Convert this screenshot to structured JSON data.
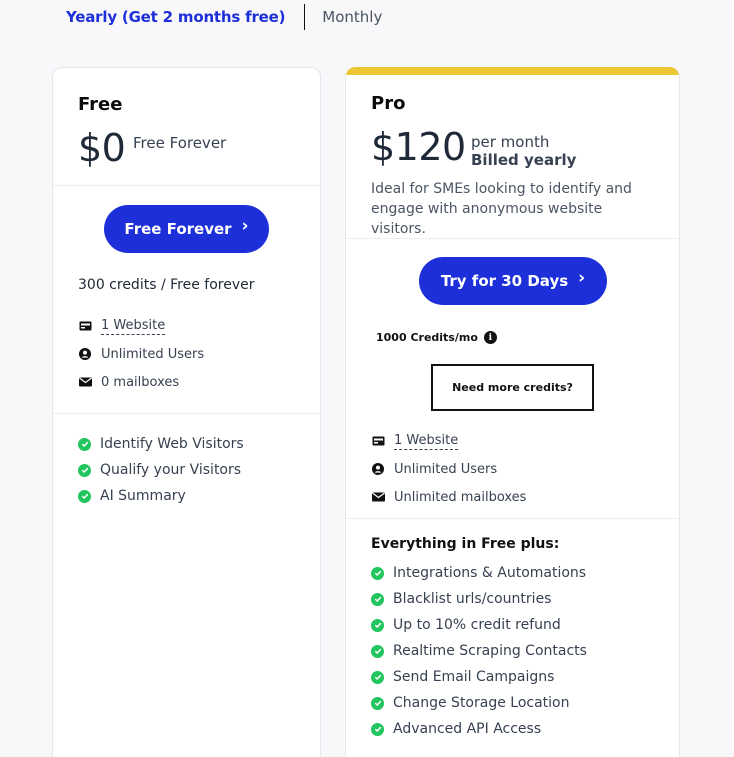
{
  "billing": {
    "yearly_label": "Yearly (Get 2 months free)",
    "monthly_label": "Monthly"
  },
  "colors": {
    "accent": "#1d2fd8",
    "pro_bar": "#ebc832",
    "check": "#22c55e"
  },
  "free": {
    "name": "Free",
    "price": "$0",
    "price_note": "Free Forever",
    "cta_label": "Free Forever",
    "credits": "300 credits / Free forever",
    "meta": [
      {
        "icon": "website-icon",
        "label": "1 Website",
        "link": true
      },
      {
        "icon": "user-icon",
        "label": "Unlimited Users",
        "link": false
      },
      {
        "icon": "mail-icon",
        "label": "0 mailboxes",
        "link": false
      }
    ],
    "features": [
      "Identify Web Visitors",
      "Qualify your Visitors",
      "AI Summary"
    ]
  },
  "pro": {
    "name": "Pro",
    "price": "$120",
    "price_note": "per month",
    "price_sub": "Billed yearly",
    "description": "Ideal for SMEs looking to identify and engage with anonymous website visitors.",
    "cta_label": "Try for 30 Days",
    "credits": "1000 Credits/mo",
    "more_credits_label": "Need more credits?",
    "meta": [
      {
        "icon": "website-icon",
        "label": "1 Website",
        "link": true
      },
      {
        "icon": "user-icon",
        "label": "Unlimited Users",
        "link": false
      },
      {
        "icon": "mail-icon",
        "label": "Unlimited mailboxes",
        "link": false
      }
    ],
    "features_title": "Everything in Free plus:",
    "features": [
      "Integrations & Automations",
      "Blacklist urls/countries",
      "Up to 10% credit refund",
      "Realtime Scraping Contacts",
      "Send Email Campaigns",
      "Change Storage Location",
      "Advanced API Access"
    ]
  }
}
